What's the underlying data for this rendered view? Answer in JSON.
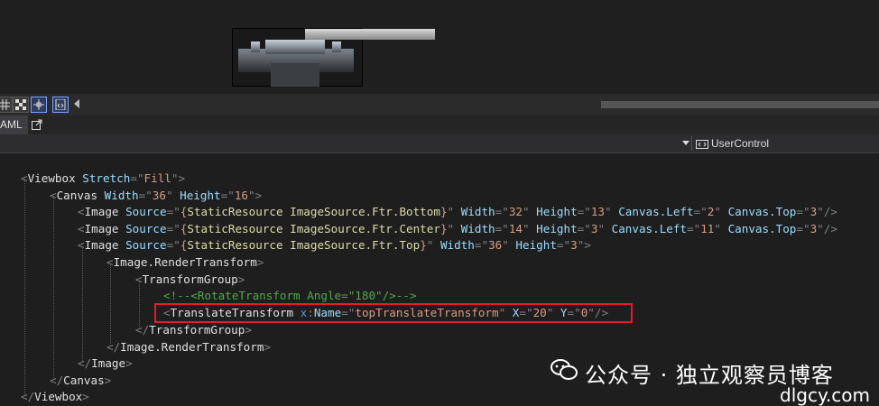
{
  "editor": {
    "lines": [
      [
        [
          "p",
          "<"
        ],
        [
          "el",
          "Viewbox"
        ],
        [
          "at",
          " Stretch"
        ],
        [
          "p",
          "="
        ],
        [
          "p",
          "\""
        ],
        [
          "v",
          "Fill"
        ],
        [
          "p",
          "\">"
        ]
      ],
      [
        [
          "p",
          "<"
        ],
        [
          "el",
          "Canvas"
        ],
        [
          "at",
          " Width"
        ],
        [
          "p",
          "="
        ],
        [
          "p",
          "\""
        ],
        [
          "v",
          "36"
        ],
        [
          "p",
          "\""
        ],
        [
          "at",
          " Height"
        ],
        [
          "p",
          "="
        ],
        [
          "p",
          "\""
        ],
        [
          "v",
          "16"
        ],
        [
          "p",
          "\">"
        ]
      ],
      [
        [
          "p",
          "<"
        ],
        [
          "el",
          "Image"
        ],
        [
          "at",
          " Source"
        ],
        [
          "p",
          "="
        ],
        [
          "p",
          "\""
        ],
        [
          "sr",
          "{"
        ],
        [
          "mk",
          "StaticResource"
        ],
        [
          "sr",
          " "
        ],
        [
          "mk",
          "ImageSource.Ftr.Bottom"
        ],
        [
          "sr",
          "}"
        ],
        [
          "p",
          "\""
        ],
        [
          "at",
          " Width"
        ],
        [
          "p",
          "="
        ],
        [
          "p",
          "\""
        ],
        [
          "v",
          "32"
        ],
        [
          "p",
          "\""
        ],
        [
          "at",
          " Height"
        ],
        [
          "p",
          "="
        ],
        [
          "p",
          "\""
        ],
        [
          "v",
          "13"
        ],
        [
          "p",
          "\""
        ],
        [
          "at",
          " Canvas.Left"
        ],
        [
          "p",
          "="
        ],
        [
          "p",
          "\""
        ],
        [
          "v",
          "2"
        ],
        [
          "p",
          "\""
        ],
        [
          "at",
          " Canvas.Top"
        ],
        [
          "p",
          "="
        ],
        [
          "p",
          "\""
        ],
        [
          "v",
          "3"
        ],
        [
          "p",
          "\"/>"
        ]
      ],
      [
        [
          "p",
          "<"
        ],
        [
          "el",
          "Image"
        ],
        [
          "at",
          " Source"
        ],
        [
          "p",
          "="
        ],
        [
          "p",
          "\""
        ],
        [
          "sr",
          "{"
        ],
        [
          "mk",
          "StaticResource"
        ],
        [
          "sr",
          " "
        ],
        [
          "mk",
          "ImageSource.Ftr.Center"
        ],
        [
          "sr",
          "}"
        ],
        [
          "p",
          "\""
        ],
        [
          "at",
          " Width"
        ],
        [
          "p",
          "="
        ],
        [
          "p",
          "\""
        ],
        [
          "v",
          "14"
        ],
        [
          "p",
          "\""
        ],
        [
          "at",
          " Height"
        ],
        [
          "p",
          "="
        ],
        [
          "p",
          "\""
        ],
        [
          "v",
          "3"
        ],
        [
          "p",
          "\""
        ],
        [
          "at",
          " Canvas.Left"
        ],
        [
          "p",
          "="
        ],
        [
          "p",
          "\""
        ],
        [
          "v",
          "11"
        ],
        [
          "p",
          "\""
        ],
        [
          "at",
          " Canvas.Top"
        ],
        [
          "p",
          "="
        ],
        [
          "p",
          "\""
        ],
        [
          "v",
          "3"
        ],
        [
          "p",
          "\"/>"
        ]
      ],
      [
        [
          "p",
          "<"
        ],
        [
          "el",
          "Image"
        ],
        [
          "at",
          " Source"
        ],
        [
          "p",
          "="
        ],
        [
          "p",
          "\""
        ],
        [
          "sr",
          "{"
        ],
        [
          "mk",
          "StaticResource"
        ],
        [
          "sr",
          " "
        ],
        [
          "mk",
          "ImageSource.Ftr.Top"
        ],
        [
          "sr",
          "}"
        ],
        [
          "p",
          "\""
        ],
        [
          "at",
          " Width"
        ],
        [
          "p",
          "="
        ],
        [
          "p",
          "\""
        ],
        [
          "v",
          "36"
        ],
        [
          "p",
          "\""
        ],
        [
          "at",
          " Height"
        ],
        [
          "p",
          "="
        ],
        [
          "p",
          "\""
        ],
        [
          "v",
          "3"
        ],
        [
          "p",
          "\">"
        ]
      ],
      [
        [
          "p",
          "<"
        ],
        [
          "el",
          "Image.RenderTransform"
        ],
        [
          "p",
          ">"
        ]
      ],
      [
        [
          "p",
          "<"
        ],
        [
          "el",
          "TransformGroup"
        ],
        [
          "p",
          ">"
        ]
      ],
      [
        [
          "cm",
          "<!--<RotateTransform Angle=\"180\"/>-->"
        ]
      ],
      [
        [
          "p",
          "<"
        ],
        [
          "el",
          "TranslateTransform"
        ],
        [
          "pf",
          " x"
        ],
        [
          "p",
          ":"
        ],
        [
          "at",
          "Name"
        ],
        [
          "p",
          "="
        ],
        [
          "p",
          "\""
        ],
        [
          "v",
          "topTranslateTransform"
        ],
        [
          "p",
          "\""
        ],
        [
          "at",
          " X"
        ],
        [
          "p",
          "="
        ],
        [
          "p",
          "\""
        ],
        [
          "v",
          "20"
        ],
        [
          "p",
          "\""
        ],
        [
          "at",
          " Y"
        ],
        [
          "p",
          "="
        ],
        [
          "p",
          "\""
        ],
        [
          "v",
          "0"
        ],
        [
          "p",
          "\"/>"
        ]
      ],
      [
        [
          "p",
          "</"
        ],
        [
          "el",
          "TransformGroup"
        ],
        [
          "p",
          ">"
        ]
      ],
      [
        [
          "p",
          "</"
        ],
        [
          "el",
          "Image.RenderTransform"
        ],
        [
          "p",
          ">"
        ]
      ],
      [
        [
          "p",
          "</"
        ],
        [
          "el",
          "Image"
        ],
        [
          "p",
          ">"
        ]
      ],
      [
        [
          "p",
          "</"
        ],
        [
          "el",
          "Canvas"
        ],
        [
          "p",
          ">"
        ]
      ],
      [
        [
          "p",
          "</"
        ],
        [
          "el",
          "Viewbox"
        ],
        [
          "p",
          ">"
        ]
      ]
    ]
  },
  "tabs": {
    "xaml_label": "AML"
  },
  "nav": {
    "type_label": "UserControl"
  },
  "watermark": {
    "text": "公众号 · 独立观察员博客",
    "url": "dlgcy.com"
  },
  "icons": {
    "toolbar": [
      "grid-icon",
      "checkerboard-icon",
      "snap-icon",
      "code-snippet-icon"
    ],
    "popout": "popout-icon",
    "usercontrol": "usercontrol-icon",
    "watermark": "wechat-icon"
  },
  "colors": {
    "highlight": "#e11d2a",
    "element": "#e0e0e0",
    "attribute": "#9cdcfe",
    "value": "#d69d85",
    "comment": "#57a64a",
    "markup_extension": "#dcdcaa"
  }
}
